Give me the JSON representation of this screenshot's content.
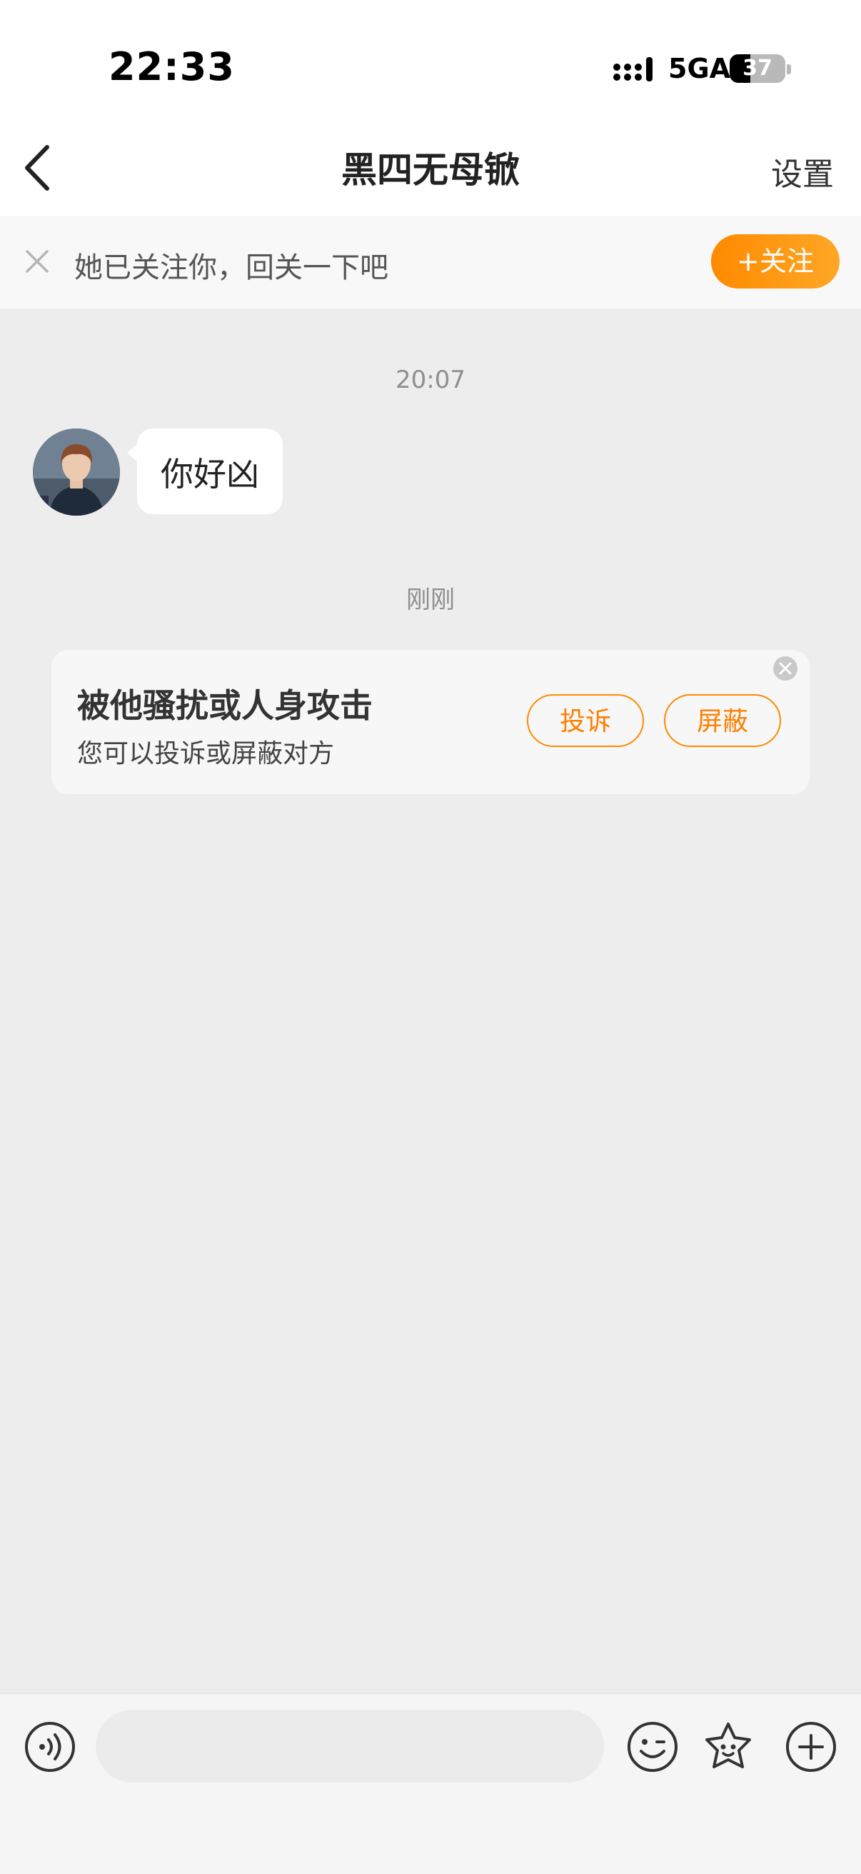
{
  "status_bar": {
    "time": "22:33",
    "network": "5GA",
    "battery_level": "37",
    "battery_fraction": 0.37
  },
  "nav": {
    "title": "黑四无母锨",
    "settings_label": "设置",
    "back_icon": "chevron-left-icon"
  },
  "follow_banner": {
    "text": "她已关注你，回关一下吧",
    "button_label": "+关注",
    "close_icon": "close-icon"
  },
  "messages": {
    "timestamp_1": "20:07",
    "incoming_text": "你好凶",
    "timestamp_2": "刚刚"
  },
  "harassment_card": {
    "title": "被他骚扰或人身攻击",
    "subtitle": "您可以投诉或屏蔽对方",
    "report_label": "投诉",
    "block_label": "屏蔽",
    "close_icon": "close-circle-icon"
  },
  "input_bar": {
    "voice_icon": "voice-icon",
    "emoji_icon": "emoji-icon",
    "sticker_icon": "sticker-icon",
    "plus_icon": "plus-circle-icon"
  },
  "colors": {
    "accent": "#ff8a00",
    "background": "#ededed"
  }
}
